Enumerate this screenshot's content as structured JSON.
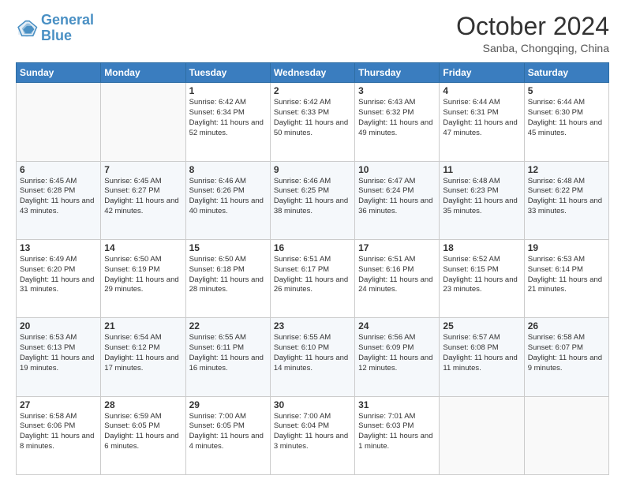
{
  "logo": {
    "line1": "General",
    "line2": "Blue"
  },
  "header": {
    "month": "October 2024",
    "location": "Sanba, Chongqing, China"
  },
  "weekdays": [
    "Sunday",
    "Monday",
    "Tuesday",
    "Wednesday",
    "Thursday",
    "Friday",
    "Saturday"
  ],
  "weeks": [
    [
      {
        "day": "",
        "info": ""
      },
      {
        "day": "",
        "info": ""
      },
      {
        "day": "1",
        "info": "Sunrise: 6:42 AM\nSunset: 6:34 PM\nDaylight: 11 hours and 52 minutes."
      },
      {
        "day": "2",
        "info": "Sunrise: 6:42 AM\nSunset: 6:33 PM\nDaylight: 11 hours and 50 minutes."
      },
      {
        "day": "3",
        "info": "Sunrise: 6:43 AM\nSunset: 6:32 PM\nDaylight: 11 hours and 49 minutes."
      },
      {
        "day": "4",
        "info": "Sunrise: 6:44 AM\nSunset: 6:31 PM\nDaylight: 11 hours and 47 minutes."
      },
      {
        "day": "5",
        "info": "Sunrise: 6:44 AM\nSunset: 6:30 PM\nDaylight: 11 hours and 45 minutes."
      }
    ],
    [
      {
        "day": "6",
        "info": "Sunrise: 6:45 AM\nSunset: 6:28 PM\nDaylight: 11 hours and 43 minutes."
      },
      {
        "day": "7",
        "info": "Sunrise: 6:45 AM\nSunset: 6:27 PM\nDaylight: 11 hours and 42 minutes."
      },
      {
        "day": "8",
        "info": "Sunrise: 6:46 AM\nSunset: 6:26 PM\nDaylight: 11 hours and 40 minutes."
      },
      {
        "day": "9",
        "info": "Sunrise: 6:46 AM\nSunset: 6:25 PM\nDaylight: 11 hours and 38 minutes."
      },
      {
        "day": "10",
        "info": "Sunrise: 6:47 AM\nSunset: 6:24 PM\nDaylight: 11 hours and 36 minutes."
      },
      {
        "day": "11",
        "info": "Sunrise: 6:48 AM\nSunset: 6:23 PM\nDaylight: 11 hours and 35 minutes."
      },
      {
        "day": "12",
        "info": "Sunrise: 6:48 AM\nSunset: 6:22 PM\nDaylight: 11 hours and 33 minutes."
      }
    ],
    [
      {
        "day": "13",
        "info": "Sunrise: 6:49 AM\nSunset: 6:20 PM\nDaylight: 11 hours and 31 minutes."
      },
      {
        "day": "14",
        "info": "Sunrise: 6:50 AM\nSunset: 6:19 PM\nDaylight: 11 hours and 29 minutes."
      },
      {
        "day": "15",
        "info": "Sunrise: 6:50 AM\nSunset: 6:18 PM\nDaylight: 11 hours and 28 minutes."
      },
      {
        "day": "16",
        "info": "Sunrise: 6:51 AM\nSunset: 6:17 PM\nDaylight: 11 hours and 26 minutes."
      },
      {
        "day": "17",
        "info": "Sunrise: 6:51 AM\nSunset: 6:16 PM\nDaylight: 11 hours and 24 minutes."
      },
      {
        "day": "18",
        "info": "Sunrise: 6:52 AM\nSunset: 6:15 PM\nDaylight: 11 hours and 23 minutes."
      },
      {
        "day": "19",
        "info": "Sunrise: 6:53 AM\nSunset: 6:14 PM\nDaylight: 11 hours and 21 minutes."
      }
    ],
    [
      {
        "day": "20",
        "info": "Sunrise: 6:53 AM\nSunset: 6:13 PM\nDaylight: 11 hours and 19 minutes."
      },
      {
        "day": "21",
        "info": "Sunrise: 6:54 AM\nSunset: 6:12 PM\nDaylight: 11 hours and 17 minutes."
      },
      {
        "day": "22",
        "info": "Sunrise: 6:55 AM\nSunset: 6:11 PM\nDaylight: 11 hours and 16 minutes."
      },
      {
        "day": "23",
        "info": "Sunrise: 6:55 AM\nSunset: 6:10 PM\nDaylight: 11 hours and 14 minutes."
      },
      {
        "day": "24",
        "info": "Sunrise: 6:56 AM\nSunset: 6:09 PM\nDaylight: 11 hours and 12 minutes."
      },
      {
        "day": "25",
        "info": "Sunrise: 6:57 AM\nSunset: 6:08 PM\nDaylight: 11 hours and 11 minutes."
      },
      {
        "day": "26",
        "info": "Sunrise: 6:58 AM\nSunset: 6:07 PM\nDaylight: 11 hours and 9 minutes."
      }
    ],
    [
      {
        "day": "27",
        "info": "Sunrise: 6:58 AM\nSunset: 6:06 PM\nDaylight: 11 hours and 8 minutes."
      },
      {
        "day": "28",
        "info": "Sunrise: 6:59 AM\nSunset: 6:05 PM\nDaylight: 11 hours and 6 minutes."
      },
      {
        "day": "29",
        "info": "Sunrise: 7:00 AM\nSunset: 6:05 PM\nDaylight: 11 hours and 4 minutes."
      },
      {
        "day": "30",
        "info": "Sunrise: 7:00 AM\nSunset: 6:04 PM\nDaylight: 11 hours and 3 minutes."
      },
      {
        "day": "31",
        "info": "Sunrise: 7:01 AM\nSunset: 6:03 PM\nDaylight: 11 hours and 1 minute."
      },
      {
        "day": "",
        "info": ""
      },
      {
        "day": "",
        "info": ""
      }
    ]
  ]
}
